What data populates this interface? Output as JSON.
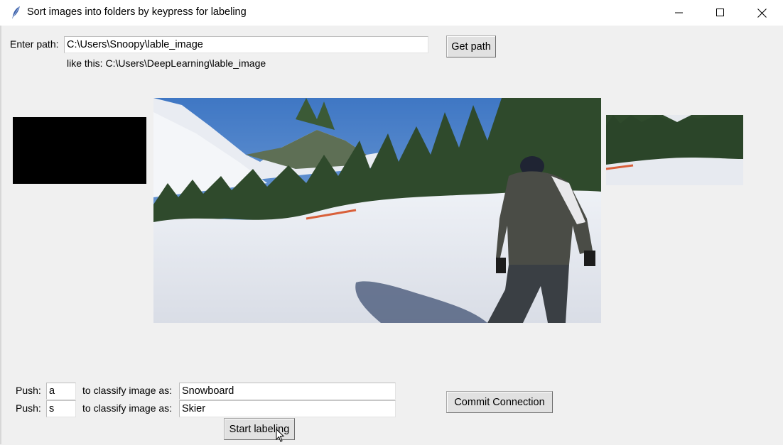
{
  "window": {
    "title": "Sort images into folders by keypress for labeling",
    "minimize_icon": "minimize-icon",
    "maximize_icon": "maximize-icon",
    "close_icon": "close-icon"
  },
  "path": {
    "label": "Enter path:",
    "value": "C:\\Users\\Snoopy\\lable_image",
    "hint": "like this:  C:\\Users\\DeepLearning\\lable_image",
    "button": "Get path"
  },
  "images": {
    "previous": "black-thumbnail",
    "current": "snowboarder-on-ski-slope",
    "next": "ski-slope-thumbnail"
  },
  "classes": [
    {
      "push_label": "Push:",
      "key": "a",
      "classify_label": "to classify image as:",
      "class_name": "Snowboard"
    },
    {
      "push_label": "Push:",
      "key": "s",
      "classify_label": "to classify image as:",
      "class_name": "Skier"
    }
  ],
  "buttons": {
    "commit": "Commit Connection",
    "start": "Start labeling"
  },
  "colors": {
    "background": "#f0f0f0",
    "titlebar": "#ffffff"
  }
}
